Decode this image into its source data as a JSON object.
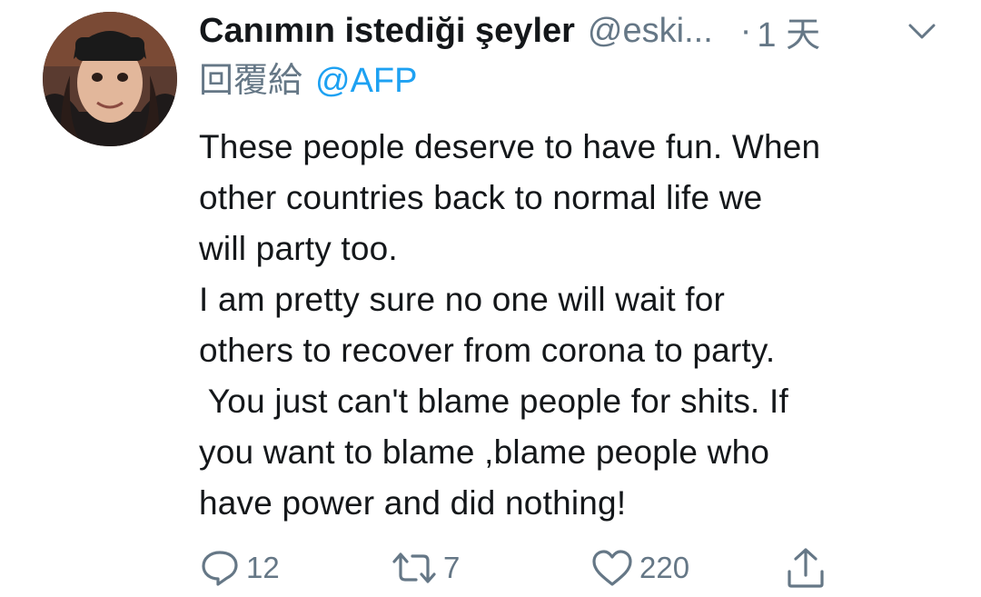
{
  "tweet": {
    "display_name": "Canımın istediği şeyler",
    "handle": "@eski...",
    "separator": "·",
    "time": "1 天",
    "reply_prefix": "回覆給",
    "reply_to": "@AFP",
    "lines": [
      "These people deserve to have fun. When",
      "other countries back to normal life we",
      "will party too.",
      "I am pretty sure no one will wait for",
      "others to recover from corona to party.",
      " You just can't blame people for shits. If",
      "you want to blame ,blame people who",
      "have power and did nothing!"
    ]
  },
  "actions": {
    "reply_count": "12",
    "retweet_count": "7",
    "like_count": "220"
  },
  "icons": {
    "reply": "reply-icon",
    "retweet": "retweet-icon",
    "like": "heart-icon",
    "share": "share-icon",
    "more": "chevron-down-icon"
  },
  "colors": {
    "text": "#14171a",
    "muted": "#657786",
    "link": "#1da1f2"
  }
}
